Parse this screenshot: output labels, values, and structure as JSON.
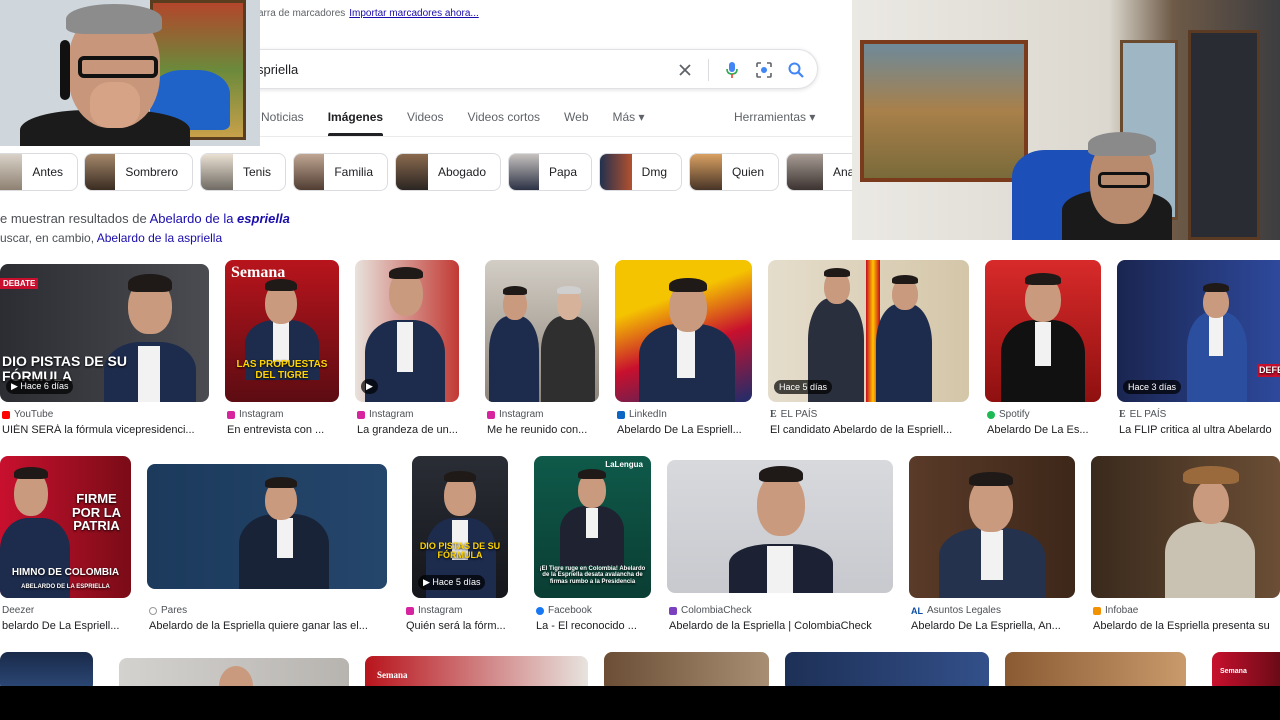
{
  "bookmarks": {
    "text": "arra de marcadores",
    "link": "Importar marcadores ahora..."
  },
  "search": {
    "query": "spriella"
  },
  "tabs": [
    "Noticias",
    "Imágenes",
    "Videos",
    "Videos cortos",
    "Web",
    "Más ▾"
  ],
  "tools_label": "Herramientas ▾",
  "chips": [
    "Antes",
    "Sombrero",
    "Tenis",
    "Familia",
    "Abogado",
    "Papa",
    "Dmg",
    "Quien",
    "Ana"
  ],
  "notice": {
    "prefix": "e muestran resultados de ",
    "link_plain": "Abelardo de la ",
    "link_bold": "espriella",
    "line2_prefix": "uscar, en cambio, ",
    "line2_link": "Abelardo de la aspriella"
  },
  "results_row1": [
    {
      "source": "YouTube",
      "title": "UIÉN SERÁ la fórmula vicepresidenci...",
      "badge": "▶ Hace 6 días",
      "overlay": "DIO PISTAS DE SU FÓRMULA",
      "brand": "DEBATE"
    },
    {
      "source": "Instagram",
      "title": "En entrevista con ...",
      "overlay": "LAS PROPUESTAS DEL TIGRE",
      "brand": "Semana"
    },
    {
      "source": "Instagram",
      "title": "La grandeza de un...",
      "badge": "▶"
    },
    {
      "source": "Instagram",
      "title": "Me he reunido con..."
    },
    {
      "source": "LinkedIn",
      "title": "Abelardo De La Espriell..."
    },
    {
      "source": "EL PAÍS",
      "title": "El candidato Abelardo de la Espriell...",
      "badge": "Hace 5 días"
    },
    {
      "source": "Spotify",
      "title": "Abelardo De La Es..."
    },
    {
      "source": "EL PAÍS",
      "title": "La FLIP critica al ultra Abelardo",
      "badge": "Hace 3 días",
      "overlay": "DEFE"
    }
  ],
  "results_row2": [
    {
      "source": "Deezer",
      "title": "belardo De La Espriell...",
      "overlay": "FIRME POR LA PATRIA",
      "overlay2": "HIMNO DE COLOMBIA",
      "overlay3": "ABELARDO DE LA ESPRIELLA"
    },
    {
      "source": "Pares",
      "title": "Abelardo de la Espriella quiere ganar las el..."
    },
    {
      "source": "Instagram",
      "title": "Quién será la fórm...",
      "badge": "▶ Hace 5 días",
      "overlay": "DIO PISTAS DE SU FÓRMULA"
    },
    {
      "source": "Facebook",
      "title": "La - El reconocido ...",
      "overlay": "¡El Tigre ruge en Colombia! Abelardo de la Espriella desata avalancha de firmas rumbo a la Presidencia",
      "brand": "LaLengua"
    },
    {
      "source": "ColombiaCheck",
      "title": "Abelardo de la Espriella | ColombiaCheck"
    },
    {
      "source": "Asuntos Legales",
      "title": "Abelardo De La Espriella, An..."
    },
    {
      "source": "Infobae",
      "title": "Abelardo de la Espriella presenta su"
    }
  ],
  "results_row3": [
    {
      "brand": ""
    },
    {
      "brand": ""
    },
    {
      "brand": "Semana"
    },
    {
      "brand": ""
    },
    {
      "brand": ""
    },
    {
      "brand": ""
    },
    {
      "brand": "Semana"
    }
  ],
  "colors": {
    "link": "#1a0dab",
    "accent": "#202124"
  }
}
